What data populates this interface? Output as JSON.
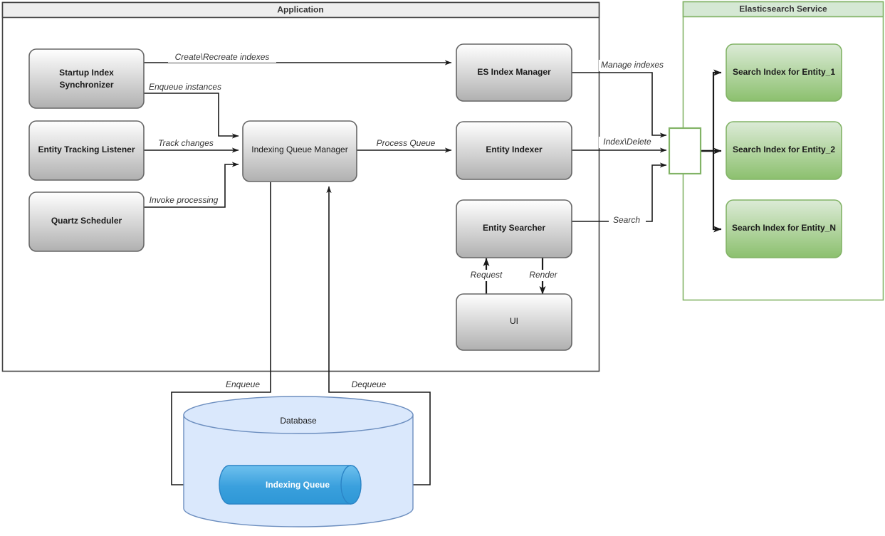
{
  "containers": {
    "application": {
      "title": "Application"
    },
    "elasticsearch": {
      "title": "Elasticsearch Service"
    }
  },
  "nodes": {
    "startup_index_synchronizer": {
      "line1": "Startup Index",
      "line2": "Synchronizer"
    },
    "entity_tracking_listener": {
      "label": "Entity Tracking Listener"
    },
    "quartz_scheduler": {
      "label": "Quartz Scheduler"
    },
    "indexing_queue_manager": {
      "label": "Indexing Queue Manager"
    },
    "es_index_manager": {
      "label": "ES Index Manager"
    },
    "entity_indexer": {
      "label": "Entity Indexer"
    },
    "entity_searcher": {
      "label": "Entity Searcher"
    },
    "ui": {
      "label": "UI"
    },
    "search_index_entity_1": {
      "label": "Search Index for Entity_1"
    },
    "search_index_entity_2": {
      "label": "Search Index for Entity_2"
    },
    "search_index_entity_n": {
      "label": "Search Index for Entity_N"
    },
    "database": {
      "label": "Database"
    },
    "indexing_queue": {
      "label": "Indexing Queue"
    }
  },
  "edges": {
    "create_recreate_indexes": {
      "label": "Create\\Recreate indexes"
    },
    "enqueue_instances": {
      "label": "Enqueue instances"
    },
    "track_changes": {
      "label": "Track changes"
    },
    "invoke_processing": {
      "label": "Invoke processing"
    },
    "process_queue": {
      "label": "Process Queue"
    },
    "manage_indexes": {
      "label": "Manage indexes"
    },
    "index_delete": {
      "label": "Index\\Delete"
    },
    "search": {
      "label": "Search"
    },
    "request": {
      "label": "Request"
    },
    "render": {
      "label": "Render"
    },
    "enqueue": {
      "label": "Enqueue"
    },
    "dequeue": {
      "label": "Dequeue"
    }
  },
  "colors": {
    "gray_box_top": "#ffffff",
    "gray_box_bottom": "#b3b3b3",
    "gray_box_border": "#666666",
    "green_box_top": "#d5e8d4",
    "green_box_bottom": "#82b366",
    "green_border": "#82b366",
    "es_panel_header": "#d5e8d4",
    "app_panel_header": "#eeeeee",
    "db_fill": "#dae8fc",
    "db_border": "#6c8ebf",
    "queue_fill": "#3aa0dd",
    "queue_border": "#2b84c6",
    "edge_stroke": "#1a1a1a"
  }
}
